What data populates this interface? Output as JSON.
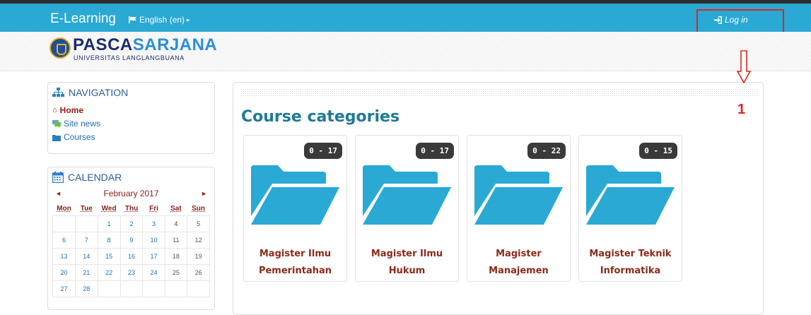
{
  "navbar": {
    "brand": "E-Learning",
    "language": "English (en)",
    "login": "Log in"
  },
  "header": {
    "logo_part1": "PASCA",
    "logo_part2": "SARJANA",
    "logo_subtitle": "UNIVERSITAS LANGLANGBUANA"
  },
  "navigation": {
    "title": "NAVIGATION",
    "items": [
      {
        "label": "Home",
        "icon": "home-icon"
      },
      {
        "label": "Site news",
        "icon": "chat-icon"
      },
      {
        "label": "Courses",
        "icon": "folder-icon"
      }
    ]
  },
  "calendar": {
    "title": "CALENDAR",
    "month": "February 2017",
    "prev": "◄",
    "next": "►",
    "days": [
      "Mon",
      "Tue",
      "Wed",
      "Thu",
      "Fri",
      "Sat",
      "Sun"
    ],
    "weeks": [
      [
        "",
        "",
        "1",
        "2",
        "3",
        "4",
        "5"
      ],
      [
        "6",
        "7",
        "8",
        "9",
        "10",
        "11",
        "12"
      ],
      [
        "13",
        "14",
        "15",
        "16",
        "17",
        "18",
        "19"
      ],
      [
        "20",
        "21",
        "22",
        "23",
        "24",
        "25",
        "26"
      ],
      [
        "27",
        "28",
        "",
        "",
        "",
        "",
        ""
      ]
    ]
  },
  "main": {
    "title": "Course categories",
    "categories": [
      {
        "badge": "0 - 17",
        "line1": "Magister Ilmu",
        "line2": "Pemerintahan"
      },
      {
        "badge": "0 - 17",
        "line1": "Magister Ilmu",
        "line2": "Hukum"
      },
      {
        "badge": "0 - 22",
        "line1": "Magister",
        "line2": "Manajemen"
      },
      {
        "badge": "0 - 15",
        "line1": "Magister Teknik",
        "line2": "Informatika"
      }
    ]
  },
  "annotation": {
    "step": "1",
    "color": "#e0261c"
  },
  "colors": {
    "navbar": "#29a9d4",
    "folder": "#29a9d4",
    "title": "#1f7a96",
    "link_red": "#a01813"
  }
}
